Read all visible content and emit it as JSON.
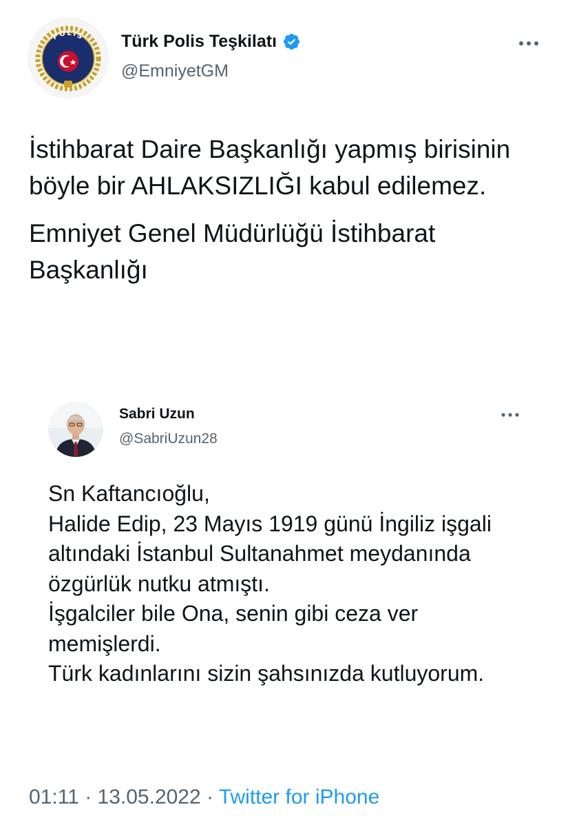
{
  "tweet": {
    "author": {
      "name": "Türk Polis Teşkilatı",
      "handle": "@EmniyetGM",
      "verified": true,
      "avatar_logo_text": "POLİS"
    },
    "text_paragraphs": [
      "İstihbarat Daire Başkanlığı yapmış birisinin böyle bir AHLAKSIZLIĞI kabul edilemez.",
      "Emniyet Genel Müdürlüğü İstihbarat Başkanlığı"
    ],
    "quoted": {
      "author": {
        "name": "Sabri Uzun",
        "handle": "@SabriUzun28"
      },
      "text": "Sn Kaftancıoğlu,\nHalide Edip, 23 Mayıs 1919 günü İngiliz işgali altındaki İstanbul Sultanahmet meydanında özgürlük nutku atmıştı.\nİşgalciler bile Ona, senin gibi ceza ver memişlerdi.\nTürk kadınlarını sizin şahsınızda kutluyorum."
    },
    "footer": {
      "time": "01:11",
      "separator": " · ",
      "date": "13.05.2022",
      "source": "Twitter for iPhone"
    },
    "colors": {
      "accent": "#1d9bf0",
      "text": "#0f1419",
      "secondary": "#536471",
      "border": "#cfd9de"
    },
    "icons": [
      "verified-badge-icon",
      "more-options-icon",
      "police-badge-logo"
    ]
  }
}
